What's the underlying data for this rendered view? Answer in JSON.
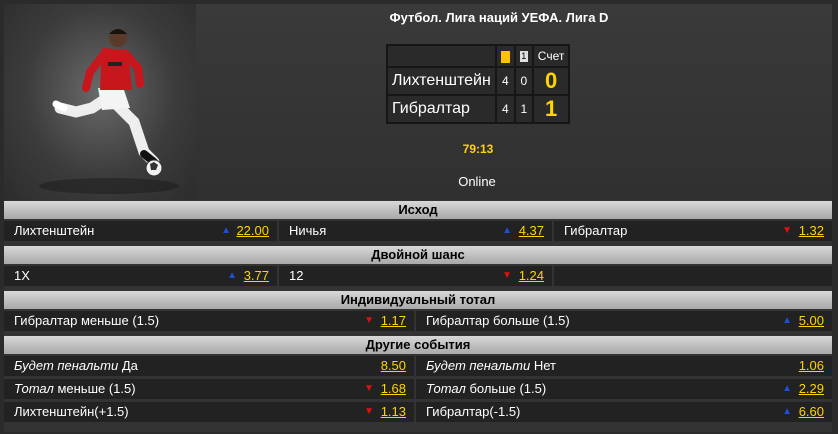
{
  "event": {
    "title": "Футбол. Лига наций УЕФА. Лига D",
    "score_header": {
      "yellow_cards_icon": "yellow-card-icon",
      "corners_num": "1",
      "score_label": "Счет"
    },
    "teams": [
      {
        "name": "Лихтенштейн",
        "yellow": "4",
        "col2": "0",
        "score": "0"
      },
      {
        "name": "Гибралтар",
        "yellow": "4",
        "col2": "1",
        "score": "1"
      }
    ],
    "time": "79:13",
    "status": "Online"
  },
  "markets": {
    "outcome": {
      "title": "Исход",
      "items": [
        {
          "label": "Лихтенштейн",
          "odd": "22.00",
          "trend": "up"
        },
        {
          "label": "Ничья",
          "odd": "4.37",
          "trend": "up"
        },
        {
          "label": "Гибралтар",
          "odd": "1.32",
          "trend": "down"
        }
      ]
    },
    "double": {
      "title": "Двойной шанс",
      "items": [
        {
          "label": "1X",
          "odd": "3.77",
          "trend": "up"
        },
        {
          "label": "12",
          "odd": "1.24",
          "trend": "down"
        }
      ]
    },
    "individual": {
      "title": "Индивидуальный тотал",
      "items": [
        {
          "label": "Гибралтар меньше (1.5)",
          "odd": "1.17",
          "trend": "down"
        },
        {
          "label": "Гибралтар больше (1.5)",
          "odd": "5.00",
          "trend": "up"
        }
      ]
    },
    "other": {
      "title": "Другие события",
      "rows": [
        [
          {
            "italic": "Будет пенальти",
            "label": " Да",
            "odd": "8.50",
            "trend": ""
          },
          {
            "italic": "Будет пенальти",
            "label": " Нет",
            "odd": "1.06",
            "trend": ""
          }
        ],
        [
          {
            "italic": "Тотал",
            "label": " меньше (1.5)",
            "odd": "1.68",
            "trend": "down"
          },
          {
            "italic": "Тотал",
            "label": " больше (1.5)",
            "odd": "2.29",
            "trend": "up"
          }
        ],
        [
          {
            "italic": "",
            "label": "Лихтенштейн(+1.5)",
            "odd": "1.13",
            "trend": "down"
          },
          {
            "italic": "",
            "label": "Гибралтар(-1.5)",
            "odd": "6.60",
            "trend": "up"
          }
        ]
      ]
    }
  },
  "arrow_glyphs": {
    "up": "▲",
    "down": "▼"
  }
}
